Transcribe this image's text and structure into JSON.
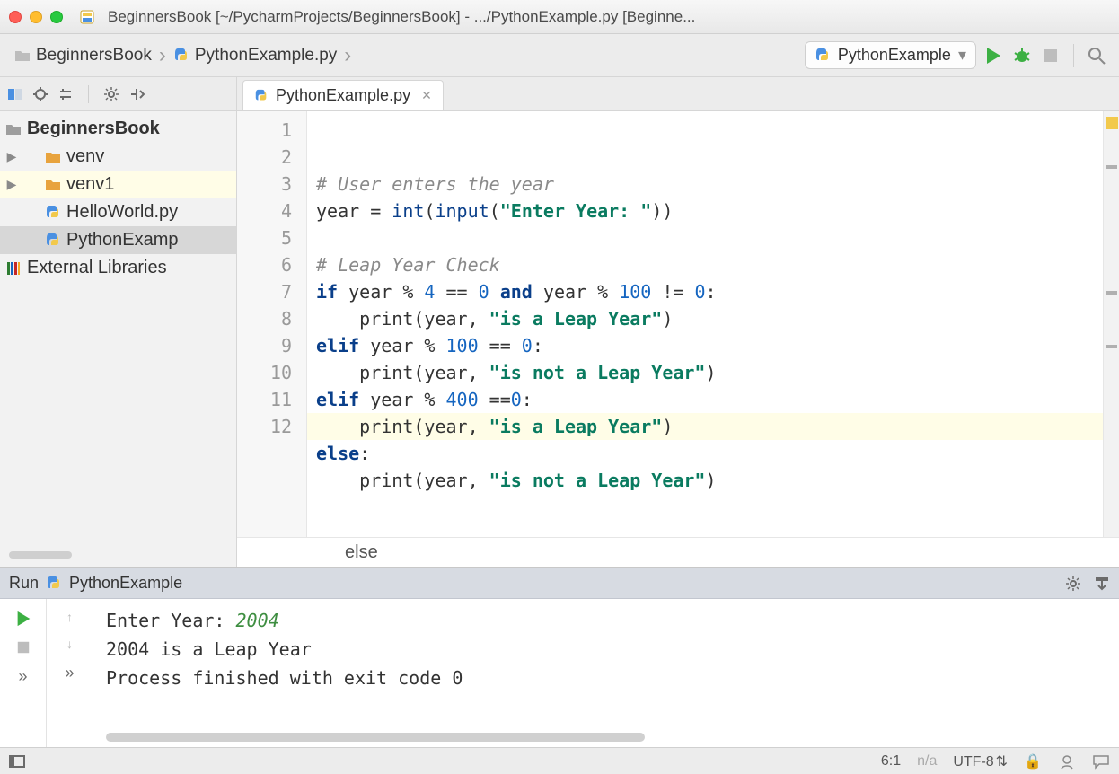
{
  "window": {
    "title": "BeginnersBook [~/PycharmProjects/BeginnersBook] - .../PythonExample.py [Beginne..."
  },
  "breadcrumb": {
    "project": "BeginnersBook",
    "file": "PythonExample.py"
  },
  "runconfig": {
    "name": "PythonExample"
  },
  "project_tree": {
    "root": "BeginnersBook",
    "items": [
      {
        "label": "venv",
        "type": "folder"
      },
      {
        "label": "venv1",
        "type": "folder"
      },
      {
        "label": "HelloWorld.py",
        "type": "py"
      },
      {
        "label": "PythonExamp",
        "type": "py",
        "selected": true
      }
    ],
    "external": "External Libraries"
  },
  "editor": {
    "tab": "PythonExample.py",
    "lines": [
      "1",
      "2",
      "3",
      "4",
      "5",
      "6",
      "7",
      "8",
      "9",
      "10",
      "11",
      "12"
    ],
    "code": {
      "l1_comment": "# User enters the year",
      "l2_a": "year = ",
      "l2_fn1": "int",
      "l2_b": "(",
      "l2_fn2": "input",
      "l2_c": "(",
      "l2_str": "\"Enter Year: \"",
      "l2_d": "))",
      "l4_comment": "# Leap Year Check",
      "l5_if": "if",
      "l5_a": " year % ",
      "l5_n4": "4",
      "l5_b": " == ",
      "l5_n0a": "0",
      "l5_and": " and ",
      "l5_c": "year % ",
      "l5_n100": "100",
      "l5_d": " != ",
      "l5_n0b": "0",
      "l5_e": ":",
      "l6_a": "    print(year, ",
      "l6_str": "\"is a Leap Year\"",
      "l6_b": ")",
      "l7_elif": "elif",
      "l7_a": " year % ",
      "l7_n100": "100",
      "l7_b": " == ",
      "l7_n0": "0",
      "l7_c": ":",
      "l8_a": "    print(year, ",
      "l8_str": "\"is not a Leap Year\"",
      "l8_b": ")",
      "l9_elif": "elif",
      "l9_a": " year % ",
      "l9_n400": "400",
      "l9_b": " ==",
      "l9_n0": "0",
      "l9_c": ":",
      "l10_a": "    print(year, ",
      "l10_str": "\"is a Leap Year\"",
      "l10_b": ")",
      "l11_else": "else",
      "l11_a": ":",
      "l12_a": "    print(year, ",
      "l12_str": "\"is not a Leap Year\"",
      "l12_b": ")"
    },
    "crumb": "else"
  },
  "run": {
    "header_label": "Run",
    "config": "PythonExample",
    "console": {
      "line1_prompt": "Enter Year: ",
      "line1_input": "2004",
      "line2": "2004 is a Leap Year",
      "line3": "",
      "line4": "Process finished with exit code 0"
    }
  },
  "status": {
    "pos": "6:1",
    "na": "n/a",
    "enc": "UTF-8"
  }
}
